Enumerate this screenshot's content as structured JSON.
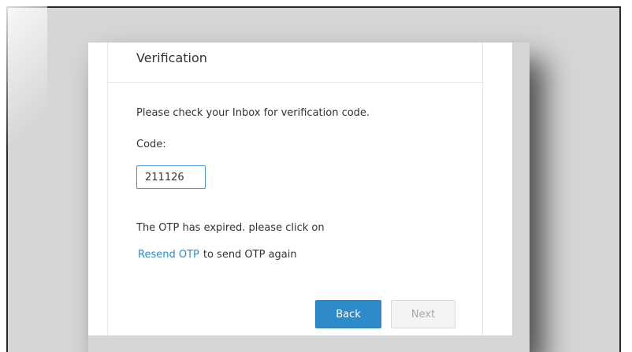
{
  "dialog": {
    "title": "Verification",
    "instruction": "Please check your Inbox for verification code.",
    "code_label": "Code:",
    "code_value": "211126",
    "otp_message": "The OTP has expired. please click on",
    "resend_link": "Resend OTP",
    "resend_suffix": "to send OTP again",
    "back_label": "Back",
    "next_label": "Next",
    "next_disabled": true
  },
  "colors": {
    "accent": "#2e8bc9",
    "backdrop": "#d6d6d6",
    "disabled_text": "#a8a8a8"
  }
}
